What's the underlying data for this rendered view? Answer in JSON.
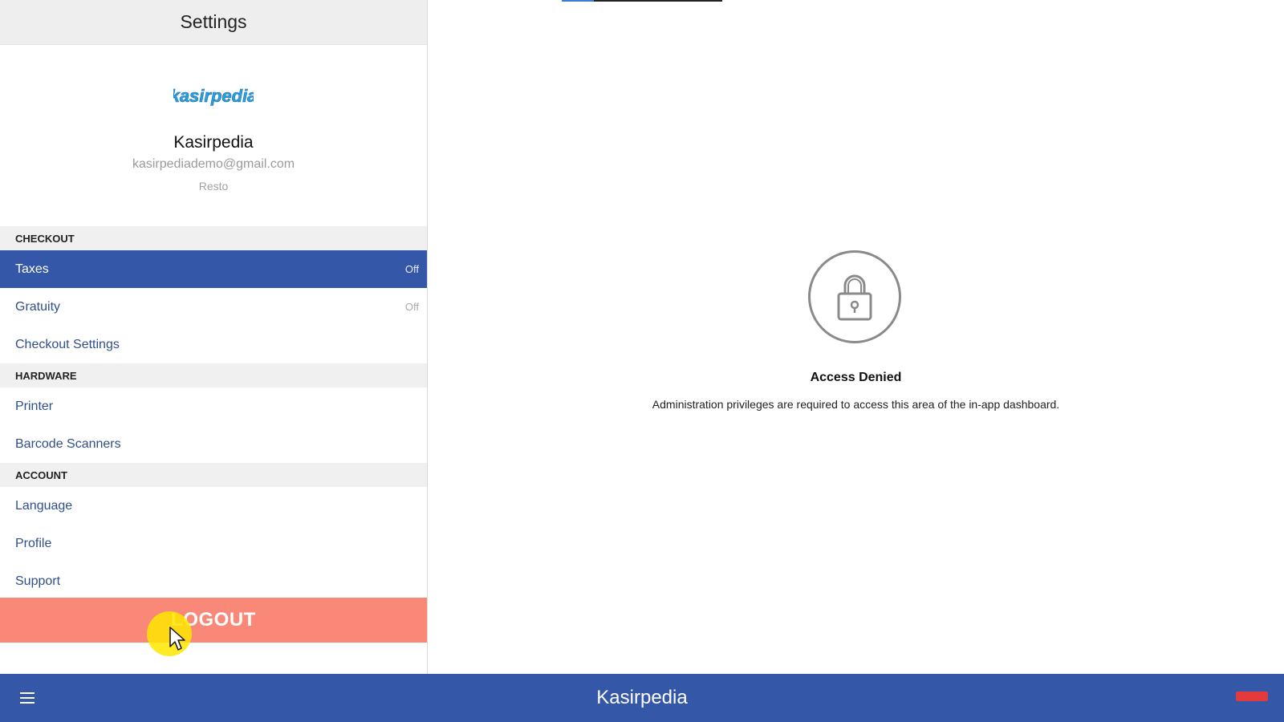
{
  "settings": {
    "title": "Settings",
    "profile": {
      "logo_text": "kasirpedia",
      "name": "Kasirpedia",
      "email": "kasirpediademo@gmail.com",
      "role": "Resto"
    },
    "sections": {
      "checkout": {
        "header": "CHECKOUT",
        "taxes": {
          "label": "Taxes",
          "value": "Off"
        },
        "gratuity": {
          "label": "Gratuity",
          "value": "Off"
        },
        "checkout_settings": {
          "label": "Checkout Settings"
        }
      },
      "hardware": {
        "header": "HARDWARE",
        "printer": {
          "label": "Printer"
        },
        "barcode_scanners": {
          "label": "Barcode Scanners"
        }
      },
      "account": {
        "header": "ACCOUNT",
        "language": {
          "label": "Language"
        },
        "profile": {
          "label": "Profile"
        },
        "support": {
          "label": "Support"
        }
      }
    },
    "logout_label": "LOGOUT"
  },
  "content": {
    "access_title": "Access Denied",
    "access_message": "Administration privileges are required to access this area of the in-app dashboard.",
    "icon": "lock-icon"
  },
  "bottom_bar": {
    "title": "Kasirpedia",
    "menu_icon": "hamburger-menu-icon"
  },
  "colors": {
    "primary": "#3557a8",
    "logout": "#f98878",
    "section_bg": "#f0f0f0",
    "header_bg": "#eeeeee"
  }
}
